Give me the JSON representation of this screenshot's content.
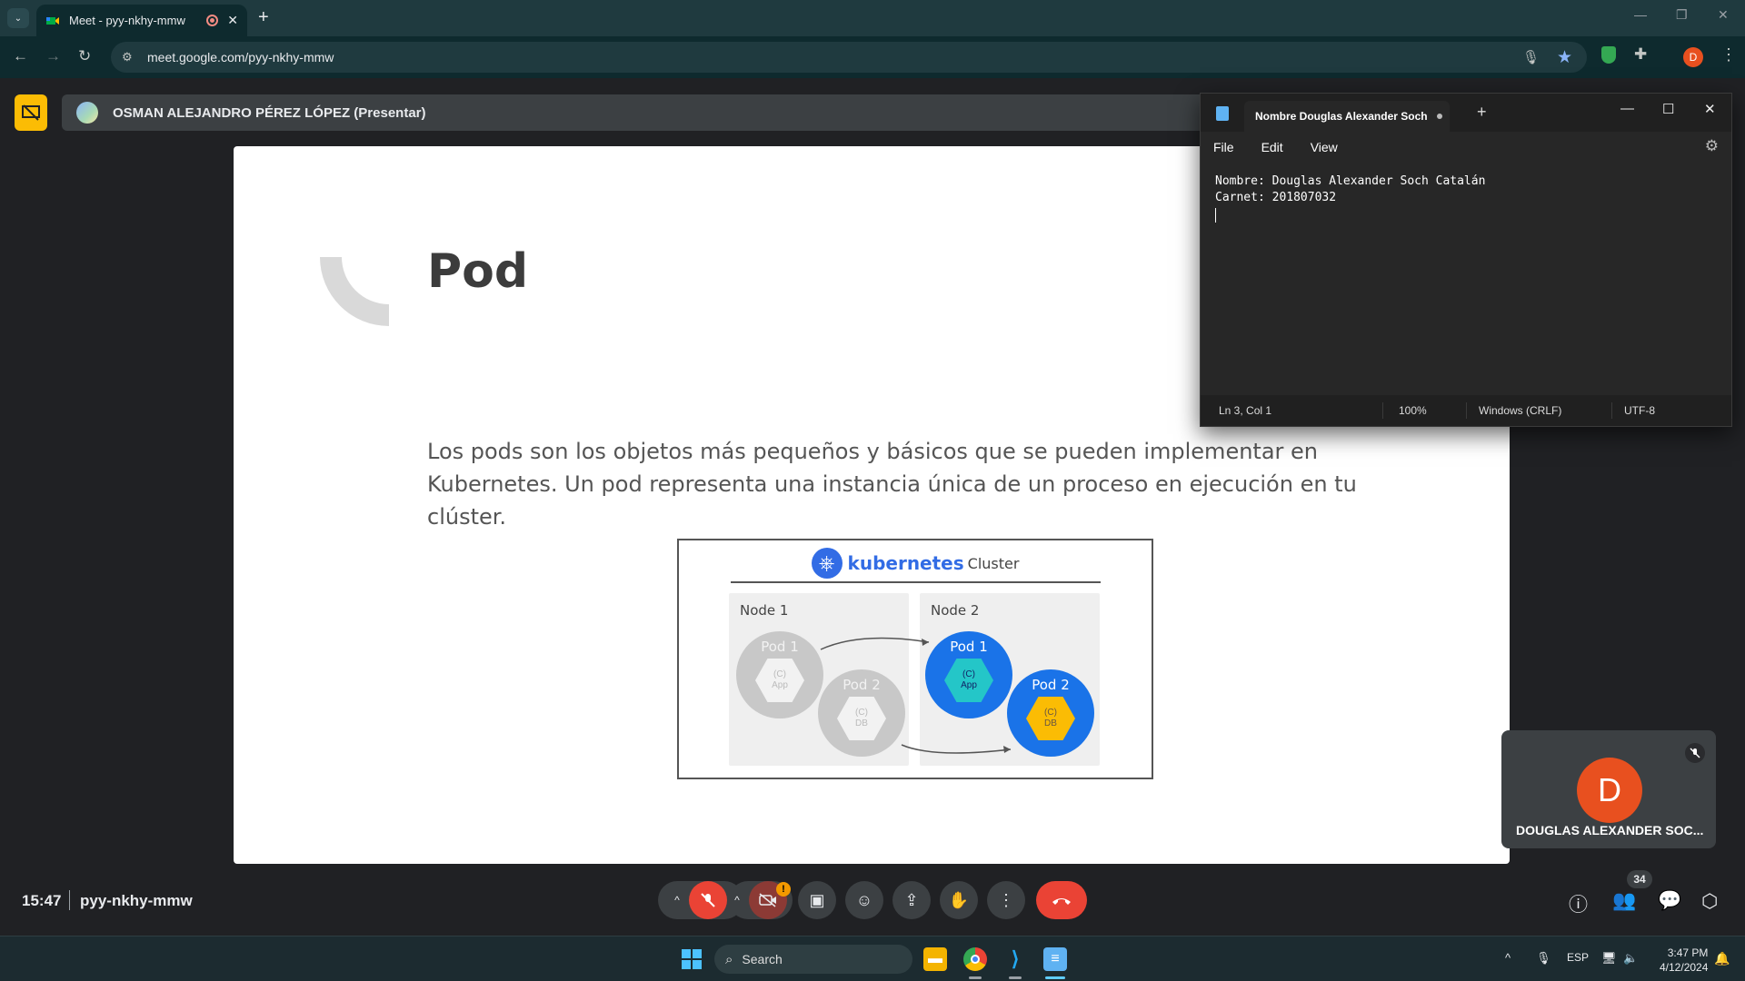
{
  "browser": {
    "tab_title": "Meet - pyy-nkhy-mmw",
    "url": "meet.google.com/pyy-nkhy-mmw"
  },
  "meet": {
    "presenter_label": "OSMAN ALEJANDRO PÉREZ LÓPEZ (Presentar)",
    "time": "15:47",
    "meeting_code": "pyy-nkhy-mmw",
    "participant_count": "34",
    "warning_badge": "!",
    "self_tile": {
      "initial": "D",
      "name": "DOUGLAS ALEXANDER SOC..."
    }
  },
  "slide": {
    "title": "Pod",
    "body": "Los pods son los objetos más pequeños y básicos que se pueden implementar en Kubernetes. Un pod representa una instancia única de un proceso en ejecución en tu clúster.",
    "diagram": {
      "brand": "kubernetes",
      "cluster_label": "Cluster",
      "node1_label": "Node 1",
      "node2_label": "Node 2",
      "pod1_label": "Pod 1",
      "pod2_label": "Pod 2",
      "app_label": "(C)\nApp",
      "db_label": "(C)\nDB"
    }
  },
  "notepad": {
    "tab_title": "Nombre Douglas Alexander Soch C",
    "menu": [
      "File",
      "Edit",
      "View"
    ],
    "content": "Nombre: Douglas Alexander Soch Catalán\nCarnet: 201807032",
    "status": {
      "position": "Ln 3, Col 1",
      "zoom": "100%",
      "line_endings": "Windows (CRLF)",
      "encoding": "UTF-8"
    }
  },
  "taskbar": {
    "search_placeholder": "Search",
    "language": "ESP",
    "time": "3:47 PM",
    "date": "4/12/2024"
  },
  "colors": {
    "accent_blue": "#1a73e8",
    "end_call_red": "#ea4335",
    "kubernetes_blue": "#326ce5"
  }
}
